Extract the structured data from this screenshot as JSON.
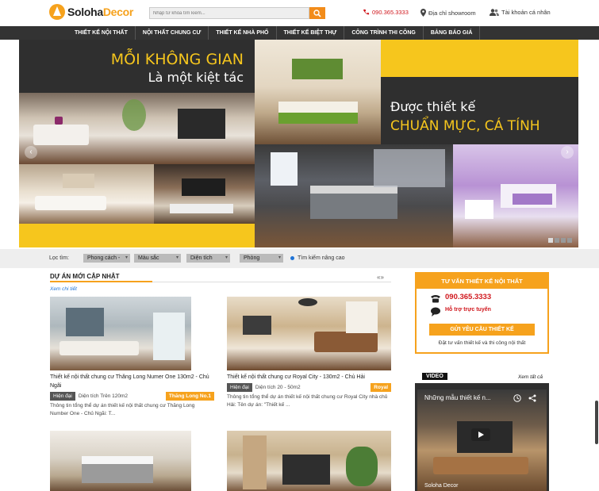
{
  "header": {
    "logo_part1": "Soloha",
    "logo_part2": "Decor",
    "search_placeholder": "Nhập từ khóa tìm kiếm...",
    "hotline": "090.365.3333",
    "showroom": "Địa chỉ showroom",
    "account": "Tài khoản cá nhân"
  },
  "nav": {
    "items": [
      {
        "label": "Thiết kế nội thất"
      },
      {
        "label": "Nội thất chung cư"
      },
      {
        "label": "Thiết kế nhà phố"
      },
      {
        "label": "Thiết kế biệt thự"
      },
      {
        "label": "Công trình thi công"
      },
      {
        "label": "Bảng báo giá"
      }
    ]
  },
  "banner": {
    "line1": "MỖI KHÔNG GIAN",
    "line2": "Là một kiệt tác",
    "line3": "Được thiết kế",
    "line4": "CHUẨN MỰC, CÁ TÍNH",
    "prev": "‹",
    "next": "›"
  },
  "filter": {
    "label": "Lọc tìm:",
    "style": "Phong cách -",
    "color": "Màu sắc",
    "area": "Diện tích",
    "room": "Phòng",
    "advanced": "Tìm kiếm nâng cao"
  },
  "section": {
    "title": "DỰ ÁN MỚI CẬP NHẬT",
    "see_detail": "Xem chi tiết",
    "arrows": "«»"
  },
  "projects": [
    {
      "title": "Thiết kế nội thất chung cư Thăng Long Numer One 130m2 - Chủ Ngãi",
      "style": "Hiện đại",
      "area": "Diện tích Trên 120m2",
      "project": "Thăng Long No.1",
      "desc": "Thông tin tổng thể dự án thiết kế nội thất chung cư Thăng Long Number One - Chủ Ngãi: T..."
    },
    {
      "title": "Thiết kế nội thất chung cư Royal City - 130m2 - Chủ Hải",
      "style": "Hiện đại",
      "area": "Diện tích 20 - 50m2",
      "project": "Royal",
      "desc": "Thông tin tổng thể dự án thiết kế nội thất chung cư Royal City nhà chủ Hải: Tên dự án: \"Thiết kế ..."
    }
  ],
  "consult": {
    "heading": "TƯ VẤN THIẾT KẾ NỘI THẤT",
    "phone": "090.365.3333",
    "online": "Hỗ trợ trực tuyến",
    "request": "GỬI YÊU CẦU THIẾT KẾ",
    "note": "Đặt tư vấn thiết kế và thi công nội thất"
  },
  "video": {
    "tag": "VIDEO",
    "see_all": "Xem tất cả",
    "title": "Những mẫu thiết kế n...",
    "channel": "Soloha Decor"
  },
  "colors": {
    "accent": "#f6a21d",
    "banner_yellow": "#f6c61d",
    "dark": "#333333",
    "hotline_red": "#d0171d"
  }
}
